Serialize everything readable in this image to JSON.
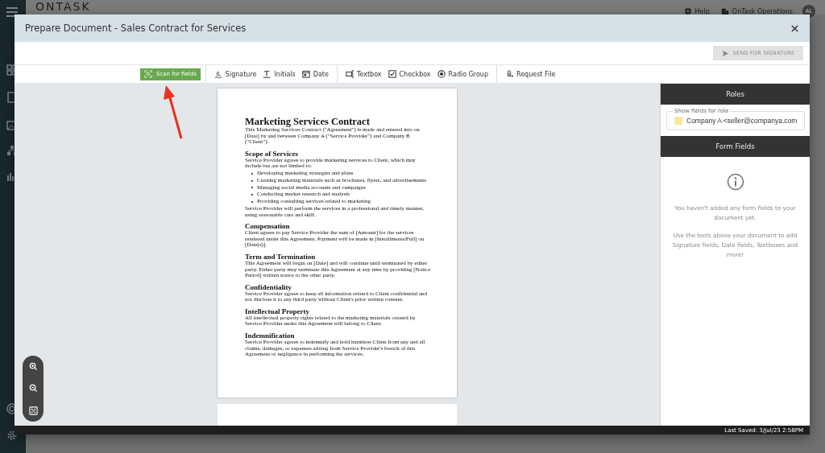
{
  "app_header": {
    "logo": "ONTASK",
    "help": "Help",
    "org": "OnTask Operations",
    "avatar": "AL"
  },
  "dialog": {
    "title": "Prepare Document - Sales Contract for Services"
  },
  "send_button": {
    "label": "SEND FOR SIGNATURE",
    "disabled": true
  },
  "toolbar": [
    [
      {
        "kind": "scan",
        "label": "Scan for fields"
      }
    ],
    [
      {
        "kind": "signature",
        "label": "Signature"
      },
      {
        "kind": "initials",
        "label": "Initials"
      },
      {
        "kind": "date",
        "label": "Date"
      }
    ],
    [
      {
        "kind": "textbox",
        "label": "Textbox"
      },
      {
        "kind": "checkbox",
        "label": "Checkbox"
      },
      {
        "kind": "radio",
        "label": "Radio Group"
      }
    ],
    [
      {
        "kind": "request",
        "label": "Request File"
      }
    ]
  ],
  "document": {
    "title": "Marketing Services Contract",
    "intro": "This Marketing Services Contract (\"Agreement\") is made and entered into on [Date] by and between Company A (\"Service Provider\") and Company B (\"Client\").",
    "sections": [
      {
        "heading": "Scope of Services",
        "blocks": [
          {
            "kind": "p",
            "text": "Service Provider agrees to provide marketing services to Client, which may include but are not limited to:"
          },
          {
            "kind": "list",
            "items": [
              "Developing marketing strategies and plans",
              "Creating marketing materials such as brochures, flyers, and advertisements",
              "Managing social media accounts and campaigns",
              "Conducting market research and analysis",
              "Providing consulting services related to marketing"
            ]
          },
          {
            "kind": "p",
            "text": "Service Provider will perform the services in a professional and timely manner, using reasonable care and skill."
          }
        ]
      },
      {
        "heading": "Compensation",
        "blocks": [
          {
            "kind": "p",
            "text": "Client agrees to pay Service Provider the sum of [Amount] for the services rendered under this Agreement. Payment will be made in [Installments/Full] on [Date(s)]."
          }
        ]
      },
      {
        "heading": "Term and Termination",
        "blocks": [
          {
            "kind": "p",
            "text": "This Agreement will begin on [Date] and will continue until terminated by either party. Either party may terminate this Agreement at any time by providing [Notice Period] written notice to the other party."
          }
        ]
      },
      {
        "heading": "Confidentiality",
        "blocks": [
          {
            "kind": "p",
            "text": "Service Provider agrees to keep all information related to Client confidential and not disclose it to any third party without Client's prior written consent."
          }
        ]
      },
      {
        "heading": "Intellectual Property",
        "blocks": [
          {
            "kind": "p",
            "text": "All intellectual property rights related to the marketing materials created by Service Provider under this Agreement will belong to Client."
          }
        ]
      },
      {
        "heading": "Indemnification",
        "blocks": [
          {
            "kind": "p",
            "text": "Service Provider agrees to indemnify and hold harmless Client from any and all claims, damages, or expenses arising from Service Provider's breach of this Agreement or negligence in performing the services."
          }
        ]
      }
    ]
  },
  "roles": {
    "heading": "Roles",
    "field_label": "Show fields for role",
    "value": "Company A <seller@companya.com",
    "color": "#f6eaa0"
  },
  "form_fields": {
    "heading": "Form Fields",
    "messages": [
      "You haven't added any form fields to your document yet.",
      "Use the tools above your document to add Signature fields, Date fields, Textboxes and more!"
    ]
  },
  "status_bar": {
    "last_saved": "Last Saved: 3/Jul/23 2:58PM"
  }
}
